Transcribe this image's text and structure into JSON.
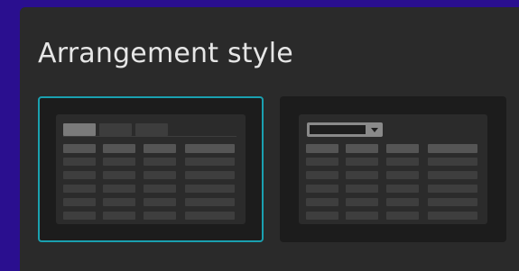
{
  "section": {
    "title": "Arrangement style"
  },
  "options": [
    {
      "id": "tabs",
      "selected": true,
      "accent": "#1aa0b0",
      "preview_icon": "tabbed-table-preview-icon"
    },
    {
      "id": "dropdown",
      "selected": false,
      "preview_icon": "dropdown-table-preview-icon"
    }
  ],
  "colors": {
    "background": "#2a0f8f",
    "panel": "#2a2a2a",
    "card": "#1c1c1c",
    "text": "#e6e6e6"
  }
}
